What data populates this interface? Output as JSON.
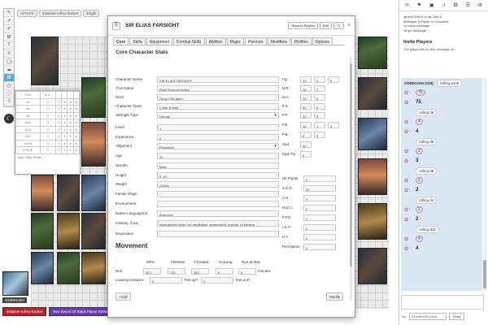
{
  "toolbar": {
    "tools": [
      "chat-icon",
      "pointer-icon",
      "pen-icon",
      "ruler-icon",
      "text-icon",
      "layers-icon",
      "shapes-icon",
      "fog-icon",
      "dice-icon",
      "timer-icon",
      "info-icon",
      "help-icon"
    ],
    "active_index": 8
  },
  "mode_buttons": [
    "ATTACK",
    "initiative-roll-to-tracker",
    "knight"
  ],
  "initiative": {
    "headers": [
      "Ord",
      "B.S.",
      "",
      "",
      "",
      ""
    ],
    "rows": [
      [
        "d4",
        "2",
        "3",
        "4",
        "5",
        "6"
      ],
      [
        "d6",
        "2",
        "3",
        "4",
        "5",
        "6"
      ],
      [
        "d8",
        "2",
        "3",
        "4",
        "5",
        "6"
      ],
      [
        "d10",
        "2",
        "3",
        "4",
        "5",
        "6"
      ],
      [
        "d12",
        "2",
        "3",
        "4",
        "5",
        "6"
      ],
      [
        "d20",
        "2",
        "3",
        "4",
        "5",
        "6"
      ],
      [
        "d100",
        "2",
        "3",
        "4",
        "5",
        "6"
      ],
      [
        "F/ODE",
        "2",
        "3",
        "4",
        "5",
        "6"
      ]
    ],
    "footer": "Adv. Click Roller"
  },
  "bottom_left": {
    "badge": "ODINKUSH",
    "macros": [
      "initiative-roll-to-tracker",
      "Neo Sword Of Black Flame Strike"
    ]
  },
  "dialog": {
    "title": "SIR ELIAS FARSIGHT",
    "header_buttons": [
      "Show to Players",
      "Edit",
      "🔍"
    ],
    "close": "×",
    "tabs": [
      "Core",
      "Skills",
      "Equipment",
      "Combat Skills",
      "Abilities",
      "Magic",
      "Psionics",
      "Modifiers",
      "Profiles",
      "Options"
    ],
    "section_title": "Core Character Stats",
    "fields": [
      {
        "label": "Character Name",
        "value": "SIR ELIAS FARSIGHT"
      },
      {
        "label": "True Name",
        "value": "Elias Tempus Hydion"
      },
      {
        "label": "Race",
        "value": "Quick Flex Alien"
      },
      {
        "label": "Character Class",
        "value": "Cyber Knight"
      },
      {
        "label": "Strength Type",
        "value": "Normal"
      },
      {
        "label": "Level",
        "value": "1"
      },
      {
        "label": "Experience",
        "value": "0"
      },
      {
        "label": "Alignment",
        "value": "Principled"
      },
      {
        "label": "Age",
        "value": "22"
      },
      {
        "label": "Gender",
        "value": "Male"
      },
      {
        "label": "Height",
        "value": "5' 10\""
      },
      {
        "label": "Weight",
        "value": "230lbs"
      },
      {
        "label": "Family Origin",
        "value": ""
      },
      {
        "label": "Environment",
        "value": ""
      },
      {
        "label": "Native Language(s)",
        "value": "American"
      },
      {
        "label": "Insanity, if any",
        "value": "hyperactivity when not meditating, strategizing, training, or fighting"
      },
      {
        "label": "Disposition",
        "value": ""
      }
    ],
    "attributes": [
      {
        "label": "I.Q.",
        "v1": "13",
        "v2": "0",
        "v3": "0"
      },
      {
        "label": "M.E.",
        "v1": "18",
        "v2": "2",
        "v3": ""
      },
      {
        "label": "M.A.",
        "v1": "14",
        "v2": "0",
        "v3": ""
      },
      {
        "label": "P.S.",
        "v1": "20",
        "v2": "5",
        "v3": ""
      },
      {
        "label": "P.P.",
        "v1": "20",
        "v2": "5",
        "v3": ""
      },
      {
        "label": "P.E.",
        "v1": "18",
        "v2": "1",
        "v3": "4"
      },
      {
        "label": "P.B.",
        "v1": "8",
        "v2": "0",
        "v3": ""
      },
      {
        "label": "Spd",
        "v1": "40",
        "v2": "",
        "v3": ""
      },
      {
        "label": "Spd: Fly",
        "v1": "0",
        "v2": "",
        "v3": ""
      }
    ],
    "derived": [
      {
        "label": "Hit Points",
        "value": "0"
      },
      {
        "label": "S.D.C.",
        "value": "30"
      },
      {
        "label": "A.R.",
        "value": "0"
      },
      {
        "label": "M.D.C.",
        "value": "0"
      },
      {
        "label": "P.P.E.",
        "value": "0"
      },
      {
        "label": "I.S.P.",
        "value": "0"
      },
      {
        "label": "H.F.",
        "value": "0"
      },
      {
        "label": "Perception",
        "value": "0"
      }
    ],
    "movement": {
      "title": "Movement",
      "headers": [
        "MPH",
        "Ft/Melee",
        "Ft/Attack",
        "Cruising",
        "Run at Max"
      ],
      "run_label": "Run",
      "run_values": [
        "32.7",
        "720",
        "360",
        "0",
        "0"
      ],
      "run_unit": "minutes",
      "leap_label": "Leaping Distance",
      "leap_up": "0",
      "leap_up_unit": "feet up?",
      "leap_out": "0",
      "leap_out_unit": "feet out?"
    },
    "add_button": "+Add",
    "modify_button": "Modify"
  },
  "sidebar": {
    "icons": [
      "chat-bubble-icon",
      "bookmark-icon",
      "image-icon",
      "music-icon",
      "dice-icon",
      "list-icon",
      "gear-icon"
    ],
    "help_lines": [
      "/gmroll 2d6+5 or /gr 2d6+5",
      "♦Whisper a Player or Character",
      "/w name message",
      "/w gm message"
    ],
    "invite_title": "Invite Players",
    "invite_text": "The player link for this campaign is:",
    "chat_header_user": "ODINKUSH (GM):",
    "chat_header_text": "rolling d100",
    "messages": [
      {
        "type": "roll",
        "text": "75"
      },
      {
        "type": "result",
        "text": "75"
      },
      {
        "type": "pill",
        "text": "rolling d6"
      },
      {
        "type": "roll",
        "text": "4"
      },
      {
        "type": "result",
        "text": "4"
      },
      {
        "type": "pill",
        "text": "rolling d8"
      },
      {
        "type": "roll",
        "text": "3"
      },
      {
        "type": "result",
        "text": "3"
      },
      {
        "type": "pill",
        "text": "rolling d6"
      },
      {
        "type": "roll",
        "text": "2"
      },
      {
        "type": "result",
        "text": "2"
      },
      {
        "type": "pill",
        "text": "rolling d4"
      },
      {
        "type": "roll",
        "text": "2"
      },
      {
        "type": "result",
        "text": "2"
      },
      {
        "type": "pill",
        "text": "rolling d10"
      },
      {
        "type": "roll",
        "text": "4"
      },
      {
        "type": "result",
        "text": "4"
      }
    ],
    "as_label": "As:",
    "as_value": "ODINKUSH (GM)",
    "send_label": "Send"
  }
}
